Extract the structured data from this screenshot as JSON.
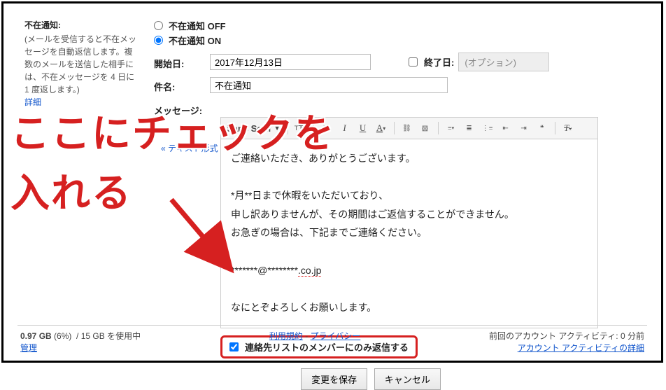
{
  "sidebar": {
    "title": "不在通知:",
    "desc": "(メールを受信すると不在メッセージを自動返信します。複数のメールを送信した相手には、不在メッセージを 4 日に 1 度返します。)",
    "link": "詳細"
  },
  "vacation": {
    "off_label": "不在通知 OFF",
    "on_label": "不在通知 ON",
    "start_label": "開始日:",
    "start_value": "2017年12月13日",
    "end_label": "終了日:",
    "end_placeholder": "(オプション)",
    "subject_label": "件名:",
    "subject_value": "不在通知",
    "message_label": "メッセージ:",
    "plain_text_link": "« テキスト形式",
    "body_lines": [
      "ご連絡いただき、ありがとうございます。",
      "",
      "*月**日まで休暇をいただいており、",
      "申し訳ありませんが、その期間はご返信することができません。",
      "お急ぎの場合は、下記までご連絡ください。",
      "",
      "*******@********.co.jp",
      "",
      "なにとぞよろしくお願いします。"
    ],
    "contacts_only_label": "連絡先リストのメンバーにのみ返信する"
  },
  "toolbar": {
    "font": "Sans Serif"
  },
  "buttons": {
    "save": "変更を保存",
    "cancel": "キャンセル"
  },
  "footer": {
    "storage_used": "0.97 GB",
    "storage_pct": "(6%)",
    "storage_total": "15 GB",
    "storage_suffix": "を使用中",
    "manage": "管理",
    "terms": "利用規約",
    "privacy": "プライバシー",
    "activity_line": "前回のアカウント アクティビティ: 0 分前",
    "activity_link": "アカウント アクティビティの詳細"
  },
  "annotation": {
    "line1": "ここにチェックを",
    "line2": "入れる"
  }
}
